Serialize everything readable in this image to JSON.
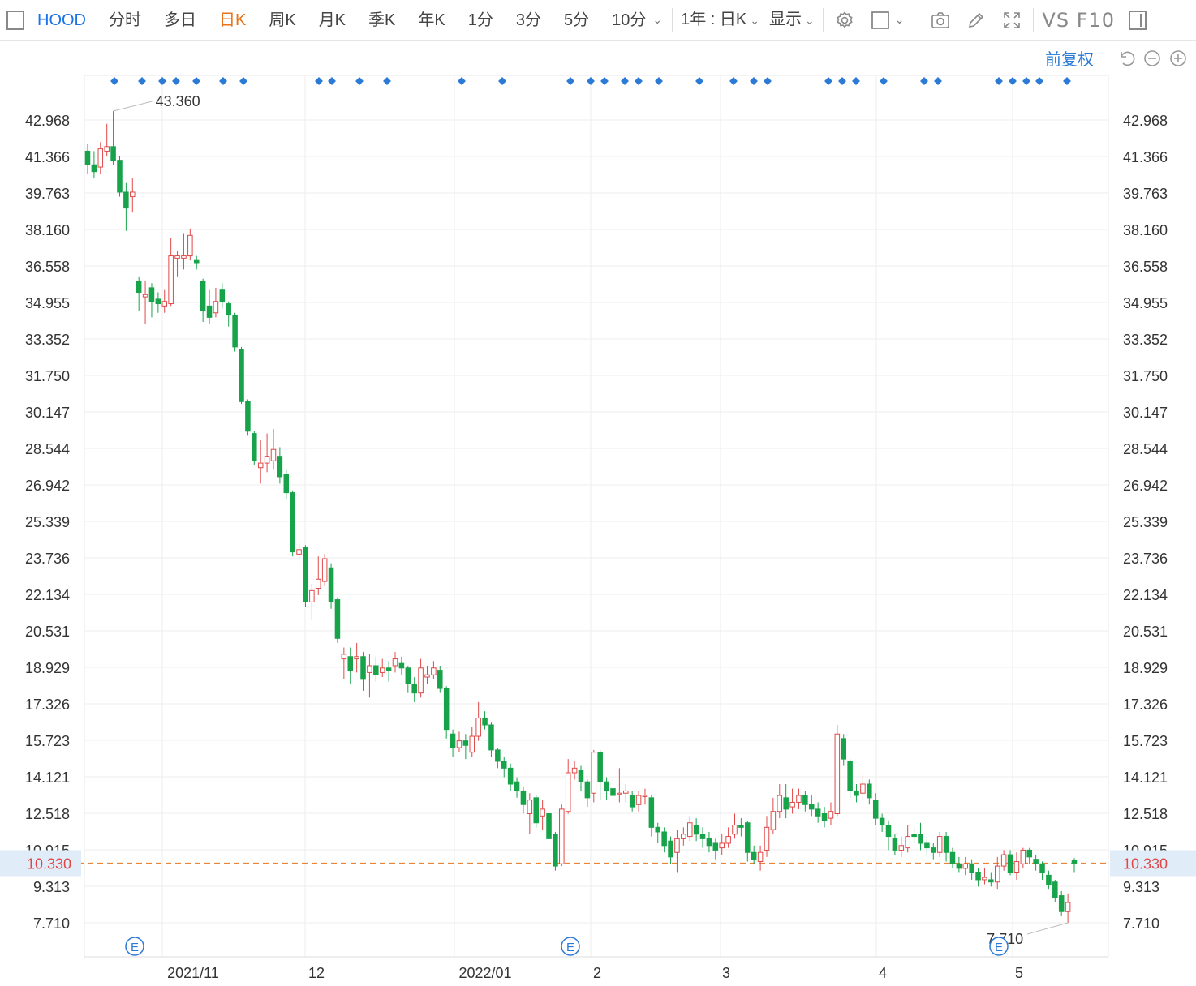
{
  "toolbar": {
    "symbol": "HOOD",
    "periods": [
      "分时",
      "多日",
      "日K",
      "周K",
      "月K",
      "季K",
      "年K",
      "1分",
      "3分",
      "5分",
      "10分"
    ],
    "active_period": "日K",
    "range_select": "1年 : 日K",
    "display_select": "显示",
    "vs_f10": "VS F10"
  },
  "adjust_label": "前复权",
  "chart_data": {
    "type": "candlestick",
    "symbol": "HOOD",
    "y_ticks": [
      42.968,
      41.366,
      39.763,
      38.16,
      36.558,
      34.955,
      33.352,
      31.75,
      30.147,
      28.544,
      26.942,
      25.339,
      23.736,
      22.134,
      20.531,
      18.929,
      17.326,
      15.723,
      14.121,
      12.518,
      10.915,
      9.313,
      7.71
    ],
    "ylim": [
      7.71,
      42.968
    ],
    "x_labels": [
      "2021/11",
      "12",
      "2022/01",
      "2",
      "3",
      "4",
      "5"
    ],
    "current_price": "10.330",
    "max_label": "43.360",
    "min_label": "7.710",
    "grid": true,
    "up_color": "#e04848",
    "down_color": "#17a34a",
    "candles": [
      [
        41.6,
        41.0,
        41.9,
        40.6
      ],
      [
        41.0,
        40.7,
        41.6,
        40.4
      ],
      [
        40.9,
        41.7,
        42.0,
        40.6
      ],
      [
        41.6,
        41.8,
        42.8,
        41.4
      ],
      [
        41.8,
        41.2,
        43.36,
        41.0
      ],
      [
        41.2,
        39.8,
        41.4,
        39.6
      ],
      [
        39.8,
        39.1,
        40.2,
        38.1
      ],
      [
        39.6,
        39.8,
        40.4,
        38.9
      ],
      [
        35.9,
        35.4,
        36.1,
        34.6
      ],
      [
        35.2,
        35.3,
        35.9,
        34.0
      ],
      [
        35.6,
        35.0,
        35.8,
        34.3
      ],
      [
        35.1,
        34.9,
        35.4,
        34.5
      ],
      [
        34.8,
        35.0,
        35.5,
        34.5
      ],
      [
        34.9,
        37.0,
        37.8,
        34.8
      ],
      [
        36.9,
        37.0,
        37.2,
        36.1
      ],
      [
        36.9,
        37.0,
        38.0,
        36.4
      ],
      [
        37.0,
        37.9,
        38.2,
        36.8
      ],
      [
        36.8,
        36.7,
        37.0,
        36.4
      ],
      [
        35.9,
        34.6,
        36.0,
        34.1
      ],
      [
        34.8,
        34.3,
        35.5,
        34.0
      ],
      [
        34.5,
        35.0,
        35.6,
        34.3
      ],
      [
        35.5,
        35.0,
        35.8,
        34.7
      ],
      [
        34.9,
        34.4,
        35.0,
        33.9
      ],
      [
        34.4,
        33.0,
        34.5,
        32.8
      ],
      [
        32.9,
        30.6,
        33.0,
        30.5
      ],
      [
        30.6,
        29.3,
        30.7,
        29.1
      ],
      [
        29.2,
        28.0,
        29.3,
        27.8
      ],
      [
        27.7,
        27.9,
        28.9,
        27.0
      ],
      [
        27.9,
        28.2,
        29.2,
        27.5
      ],
      [
        28.0,
        28.5,
        29.4,
        27.6
      ],
      [
        28.2,
        27.3,
        28.6,
        27.0
      ],
      [
        27.4,
        26.6,
        27.6,
        26.3
      ],
      [
        26.6,
        24.0,
        26.7,
        23.8
      ],
      [
        23.9,
        24.1,
        24.4,
        23.6
      ],
      [
        24.2,
        21.8,
        24.3,
        21.6
      ],
      [
        21.8,
        22.3,
        22.6,
        21.0
      ],
      [
        22.4,
        22.8,
        23.8,
        22.1
      ],
      [
        22.7,
        23.7,
        23.9,
        22.5
      ],
      [
        23.3,
        21.8,
        23.5,
        21.5
      ],
      [
        21.9,
        20.2,
        22.0,
        20.0
      ],
      [
        19.3,
        19.5,
        19.8,
        18.4
      ],
      [
        19.4,
        18.8,
        19.8,
        18.2
      ],
      [
        19.3,
        19.4,
        20.0,
        18.7
      ],
      [
        19.4,
        18.4,
        19.6,
        17.9
      ],
      [
        18.7,
        19.0,
        19.5,
        17.6
      ],
      [
        19.0,
        18.6,
        19.4,
        18.3
      ],
      [
        18.7,
        18.9,
        19.3,
        18.5
      ],
      [
        18.9,
        18.8,
        19.2,
        18.3
      ],
      [
        19.0,
        19.3,
        19.6,
        18.7
      ],
      [
        19.1,
        18.9,
        19.4,
        18.6
      ],
      [
        18.9,
        18.2,
        19.0,
        17.8
      ],
      [
        18.2,
        17.8,
        18.5,
        17.4
      ],
      [
        17.8,
        18.9,
        19.3,
        17.6
      ],
      [
        18.5,
        18.6,
        19.0,
        18.2
      ],
      [
        18.6,
        18.9,
        19.2,
        18.4
      ],
      [
        18.8,
        18.0,
        19.0,
        17.8
      ],
      [
        18.0,
        16.2,
        18.1,
        15.8
      ],
      [
        16.0,
        15.4,
        16.2,
        15.0
      ],
      [
        15.4,
        15.7,
        16.1,
        15.2
      ],
      [
        15.7,
        15.5,
        16.0,
        14.9
      ],
      [
        15.2,
        15.9,
        16.3,
        15.0
      ],
      [
        15.9,
        16.7,
        17.4,
        15.7
      ],
      [
        16.7,
        16.4,
        17.0,
        16.2
      ],
      [
        16.4,
        15.3,
        16.5,
        15.0
      ],
      [
        15.3,
        14.8,
        15.4,
        14.5
      ],
      [
        14.8,
        14.5,
        15.0,
        14.1
      ],
      [
        14.5,
        13.8,
        14.7,
        13.5
      ],
      [
        13.9,
        13.5,
        14.1,
        13.2
      ],
      [
        13.5,
        12.9,
        13.7,
        12.5
      ],
      [
        12.5,
        13.1,
        13.4,
        11.6
      ],
      [
        13.2,
        12.1,
        13.3,
        11.9
      ],
      [
        12.4,
        12.7,
        13.1,
        11.8
      ],
      [
        12.5,
        11.4,
        12.6,
        10.9
      ],
      [
        11.6,
        10.2,
        11.7,
        10.0
      ],
      [
        10.3,
        12.7,
        12.9,
        10.2
      ],
      [
        12.6,
        14.3,
        14.9,
        12.5
      ],
      [
        14.3,
        14.5,
        14.8,
        14.0
      ],
      [
        14.4,
        13.9,
        14.6,
        13.5
      ],
      [
        13.9,
        13.2,
        14.0,
        12.8
      ],
      [
        13.4,
        15.2,
        15.3,
        13.0
      ],
      [
        15.2,
        13.9,
        15.3,
        13.1
      ],
      [
        13.9,
        13.5,
        14.1,
        13.1
      ],
      [
        13.6,
        13.3,
        14.2,
        13.1
      ],
      [
        13.4,
        13.4,
        14.5,
        13.0
      ],
      [
        13.4,
        13.5,
        13.8,
        13.0
      ],
      [
        13.3,
        12.8,
        13.5,
        12.6
      ],
      [
        12.9,
        13.3,
        13.5,
        12.6
      ],
      [
        13.3,
        13.3,
        13.6,
        12.9
      ],
      [
        13.2,
        11.9,
        13.3,
        11.5
      ],
      [
        11.9,
        11.7,
        12.1,
        11.2
      ],
      [
        11.7,
        11.1,
        11.9,
        10.8
      ],
      [
        11.3,
        10.6,
        11.5,
        10.3
      ],
      [
        10.8,
        11.4,
        11.8,
        9.9
      ],
      [
        11.4,
        11.6,
        11.9,
        11.1
      ],
      [
        11.5,
        12.1,
        12.4,
        11.3
      ],
      [
        12.0,
        11.6,
        12.3,
        11.3
      ],
      [
        11.6,
        11.4,
        11.9,
        11.0
      ],
      [
        11.4,
        11.1,
        11.7,
        10.8
      ],
      [
        11.2,
        10.9,
        11.4,
        10.5
      ],
      [
        11.0,
        11.2,
        11.6,
        10.7
      ],
      [
        11.2,
        11.5,
        11.9,
        11.0
      ],
      [
        11.6,
        12.0,
        12.5,
        11.4
      ],
      [
        12.0,
        11.9,
        12.3,
        11.5
      ],
      [
        12.1,
        10.8,
        12.2,
        10.4
      ],
      [
        10.8,
        10.5,
        11.1,
        10.3
      ],
      [
        10.4,
        10.8,
        11.1,
        10.0
      ],
      [
        10.9,
        11.9,
        12.4,
        10.6
      ],
      [
        11.8,
        12.6,
        13.2,
        11.6
      ],
      [
        12.6,
        13.3,
        13.8,
        12.3
      ],
      [
        13.2,
        12.7,
        13.8,
        12.3
      ],
      [
        12.8,
        13.0,
        13.6,
        12.5
      ],
      [
        13.0,
        13.3,
        13.6,
        12.7
      ],
      [
        13.3,
        12.9,
        13.5,
        12.6
      ],
      [
        12.9,
        12.7,
        13.3,
        12.4
      ],
      [
        12.7,
        12.4,
        13.0,
        12.1
      ],
      [
        12.5,
        12.2,
        12.8,
        11.9
      ],
      [
        12.3,
        12.6,
        13.0,
        12.0
      ],
      [
        12.5,
        16.0,
        16.4,
        12.4
      ],
      [
        15.8,
        14.9,
        16.0,
        14.6
      ],
      [
        14.8,
        13.5,
        14.9,
        13.2
      ],
      [
        13.5,
        13.3,
        13.8,
        13.0
      ],
      [
        13.4,
        13.8,
        14.2,
        13.1
      ],
      [
        13.8,
        13.2,
        14.0,
        12.9
      ],
      [
        13.1,
        12.3,
        13.4,
        12.0
      ],
      [
        12.3,
        12.0,
        12.5,
        11.7
      ],
      [
        12.0,
        11.5,
        12.2,
        10.9
      ],
      [
        11.4,
        10.9,
        11.6,
        10.7
      ],
      [
        10.9,
        11.1,
        11.5,
        10.6
      ],
      [
        11.0,
        11.5,
        12.0,
        10.8
      ],
      [
        11.6,
        11.5,
        11.9,
        11.2
      ],
      [
        11.6,
        11.2,
        12.1,
        10.9
      ],
      [
        11.2,
        11.0,
        11.5,
        10.6
      ],
      [
        11.0,
        10.8,
        11.2,
        10.5
      ],
      [
        10.8,
        11.5,
        11.7,
        10.6
      ],
      [
        11.5,
        10.8,
        11.7,
        10.4
      ],
      [
        10.8,
        10.3,
        11.0,
        10.1
      ],
      [
        10.3,
        10.1,
        10.6,
        9.9
      ],
      [
        10.1,
        10.3,
        10.6,
        9.8
      ],
      [
        10.3,
        9.9,
        10.5,
        9.6
      ],
      [
        9.9,
        9.6,
        10.1,
        9.3
      ],
      [
        9.6,
        9.7,
        10.1,
        9.4
      ],
      [
        9.6,
        9.5,
        9.9,
        9.3
      ],
      [
        9.5,
        10.2,
        10.6,
        9.2
      ],
      [
        10.2,
        10.7,
        10.9,
        10.0
      ],
      [
        10.7,
        9.9,
        10.9,
        9.8
      ],
      [
        9.9,
        10.4,
        10.8,
        9.6
      ],
      [
        10.3,
        10.9,
        11.0,
        10.1
      ],
      [
        10.9,
        10.6,
        11.0,
        10.3
      ],
      [
        10.5,
        10.3,
        10.7,
        10.0
      ],
      [
        10.3,
        9.9,
        10.4,
        9.6
      ],
      [
        9.8,
        9.4,
        10.0,
        9.2
      ],
      [
        9.5,
        8.8,
        9.6,
        8.6
      ],
      [
        8.9,
        8.2,
        9.1,
        8.0
      ],
      [
        8.2,
        8.6,
        9.0,
        7.71
      ],
      [
        10.45,
        10.33,
        10.55,
        9.9
      ]
    ]
  }
}
